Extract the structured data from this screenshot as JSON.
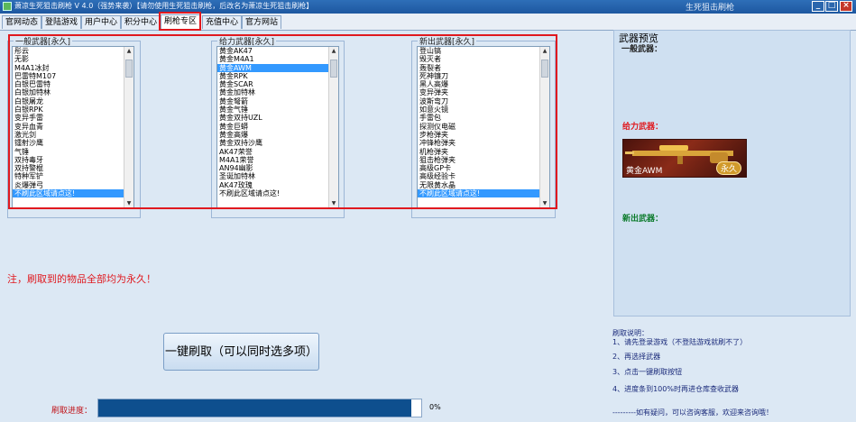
{
  "window": {
    "title": "萧凉生死狙击刷枪 V 4.0（强势来袭）【请勿使用生死狙击刷枪，后改名为萧凉生死狙击刷枪】",
    "right_title": "生死狙击刷枪",
    "min_label": "_",
    "max_label": "□",
    "close_label": "×"
  },
  "tabs": [
    "官网动态",
    "登陆游戏",
    "用户中心",
    "积分中心",
    "刷枪专区",
    "充值中心",
    "官方网站"
  ],
  "lists": {
    "general": {
      "title": "一般武器[永久]",
      "items": [
        "彤云",
        "无影",
        "M4A1冰封",
        "巴雷特M107",
        "白银巴雷特",
        "白银加特林",
        "白银屠龙",
        "白银RPK",
        "变异手雷",
        "变异血青",
        "激光剑",
        "镭射沙鹰",
        "气锤",
        "双持毒牙",
        "双持警棍",
        "特种军铲",
        "炎爆弹弓",
        "不刷此区域请点这!"
      ],
      "selected": 17
    },
    "power": {
      "title": "给力武器[永久]",
      "items": [
        "黄金AK47",
        "黄金M4A1",
        "黄金AWM",
        "黄金RPK",
        "黄金SCAR",
        "黄金加特林",
        "黄金弩箭",
        "黄金气锤",
        "黄金双持UZL",
        "黄金巨蟒",
        "黄金高爆",
        "黄金双持沙鹰",
        "AK47荣誉",
        "M4A1荣誉",
        "AN94幽影",
        "圣诞加特林",
        "AK47玫瑰",
        "不刷此区域请点这!"
      ],
      "selected": 2
    },
    "new": {
      "title": "新出武器[永久]",
      "items": [
        "登山镐",
        "毁灭者",
        "轰裂者",
        "死神镰刀",
        "黑人高爆",
        "变异弹夹",
        "波斯弯刀",
        "如意火镜",
        "手雷包",
        "探测仪电磁",
        "步枪弹夹",
        "冲锋枪弹夹",
        "机枪弹夹",
        "狙击枪弹夹",
        "高级GP卡",
        "高级经验卡",
        "无限黄水晶",
        "不刷此区域请点这!"
      ],
      "selected": 17
    }
  },
  "note": "注，刷取到的物品全部均为永久！",
  "action_button": "一键刷取（可以同时选多项）",
  "progress": {
    "label": "刷取进度：",
    "value": 0.97,
    "percent_text": "0%"
  },
  "preview": {
    "title": "武器预览",
    "general_label": "一般武器：",
    "power_label": "给力武器：",
    "new_label": "新出武器：",
    "weapon_name": "黄金AWM",
    "weapon_badge": "永久"
  },
  "instructions": {
    "title": "刷取说明：",
    "steps": [
      "1、请先登录游戏（不登陆游戏就刷不了）",
      "2、再选择武器",
      "3、点击一键刷取按钮",
      "4、进度条到100%时再进仓库查收武器"
    ],
    "footer": "---------如有疑问，可以咨询客服，欢迎来咨询哦！"
  },
  "colors": {
    "highlight": "#e0191f",
    "progress": "#0e4f8e",
    "selection": "#3399ff"
  }
}
